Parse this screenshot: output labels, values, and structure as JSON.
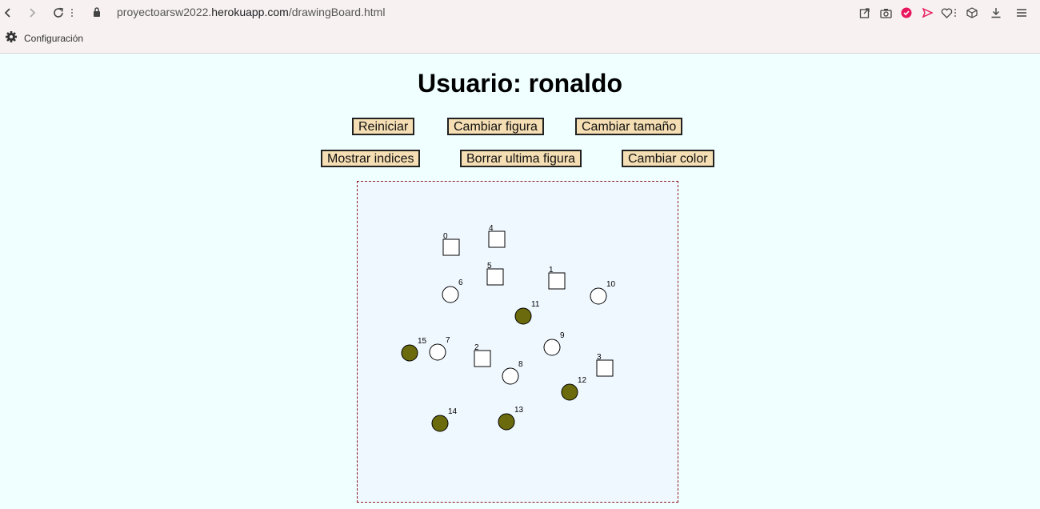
{
  "browser": {
    "url_prefix": "proyectoarsw2022.",
    "url_host": "herokuapp.com",
    "url_path": "/drawingBoard.html",
    "bookmark_label": "Configuración"
  },
  "page": {
    "title": "Usuario: ronaldo"
  },
  "buttons": {
    "reiniciar": "Reiniciar",
    "cambiar_figura": "Cambiar figura",
    "cambiar_tamano": "Cambiar tamaño",
    "mostrar_indices": "Mostrar indices",
    "borrar_ultima": "Borrar ultima figura",
    "cambiar_color": "Cambiar color"
  },
  "colors": {
    "fill_olive": "#6b6b0e",
    "fill_white": "#ffffff",
    "button_bg": "#f5deb3",
    "canvas_border": "#8b1a1a"
  },
  "figures": [
    {
      "index": "0",
      "shape": "square",
      "fill": "white"
    },
    {
      "index": "1",
      "shape": "square",
      "fill": "white"
    },
    {
      "index": "2",
      "shape": "square",
      "fill": "white"
    },
    {
      "index": "3",
      "shape": "square",
      "fill": "white"
    },
    {
      "index": "4",
      "shape": "square",
      "fill": "white"
    },
    {
      "index": "5",
      "shape": "square",
      "fill": "white"
    },
    {
      "index": "6",
      "shape": "circle",
      "fill": "white"
    },
    {
      "index": "7",
      "shape": "circle",
      "fill": "white"
    },
    {
      "index": "8",
      "shape": "circle",
      "fill": "white"
    },
    {
      "index": "9",
      "shape": "circle",
      "fill": "white"
    },
    {
      "index": "10",
      "shape": "circle",
      "fill": "white"
    },
    {
      "index": "11",
      "shape": "circle",
      "fill": "olive"
    },
    {
      "index": "12",
      "shape": "circle",
      "fill": "olive"
    },
    {
      "index": "13",
      "shape": "circle",
      "fill": "olive"
    },
    {
      "index": "14",
      "shape": "circle",
      "fill": "olive"
    },
    {
      "index": "15",
      "shape": "circle",
      "fill": "olive"
    }
  ]
}
